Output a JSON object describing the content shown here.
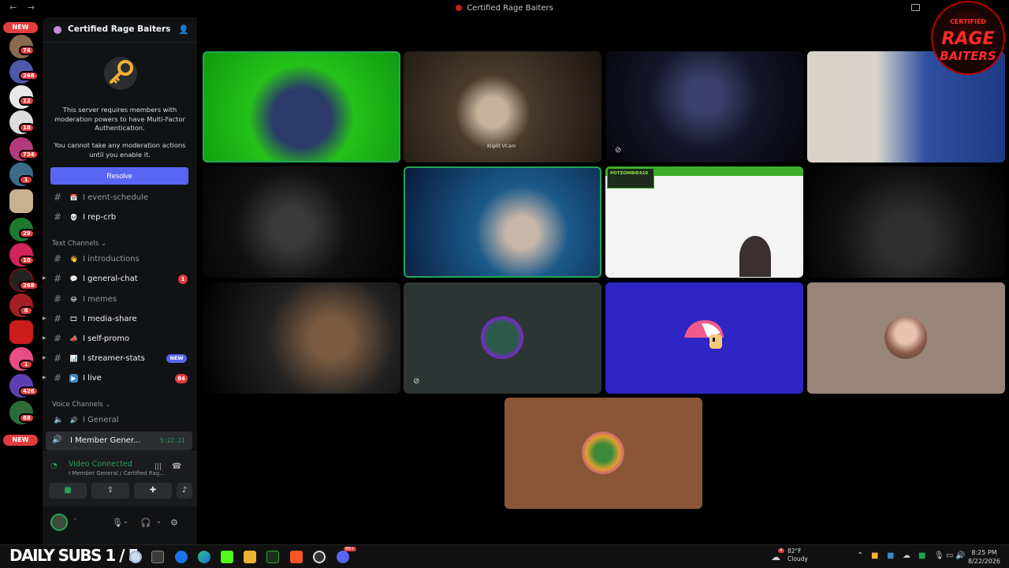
{
  "window": {
    "title": "Certified Rage Baiters",
    "back": "←",
    "forward": "→"
  },
  "rail": {
    "new_top": "NEW",
    "new_bottom": "NEW",
    "badges": [
      "74",
      "268",
      "12",
      "18",
      "734",
      "1",
      "29",
      "10",
      "268",
      "8",
      "1",
      "426",
      "68"
    ]
  },
  "server": {
    "name": "Certified Rage Baiters",
    "chevron": "⌄",
    "invite_icon": "add-user-icon"
  },
  "mfa_notice": {
    "text1": "This server requires members with moderation powers to have Multi-Factor Authentication.",
    "text2": "You cannot take any moderation actions until you enable it.",
    "button": "Resolve"
  },
  "channels_top": [
    {
      "emoji": "📅",
      "label": "I event-schedule",
      "bright": false
    },
    {
      "emoji": "💀",
      "label": "I rep-crb",
      "bright": true
    }
  ],
  "text_category": "Text Channels",
  "text_channels": [
    {
      "emoji": "👋",
      "label": "I introductions",
      "bright": false,
      "badge": ""
    },
    {
      "emoji": "💬",
      "label": "I general-chat",
      "bright": true,
      "badge": "1"
    },
    {
      "emoji": "😂",
      "label": "I memes",
      "bright": false,
      "badge": ""
    },
    {
      "emoji": "🎞",
      "label": "I media-share",
      "bright": true,
      "badge": ""
    },
    {
      "emoji": "📣",
      "label": "I self-promo",
      "bright": true,
      "badge": ""
    },
    {
      "emoji": "📊",
      "label": "I streamer-stats",
      "bright": true,
      "badge": "NEW"
    },
    {
      "emoji": "▶",
      "label": "I live",
      "bright": true,
      "badge": "84"
    }
  ],
  "voice_category": "Voice Channels",
  "voice_channels": [
    {
      "label": "I General"
    }
  ],
  "active_voice": {
    "label": "I Member Gener...",
    "time": "5:22:21"
  },
  "rtc": {
    "status": "Video Connected",
    "channel": "I Member General / Certified Rag..."
  },
  "user": {
    "name": "·",
    "sub": "·"
  },
  "taskbar": {
    "subs": "DAILY SUBS 1 / 5",
    "weather_temp": "82°F",
    "weather_desc": "Cloudy",
    "weather_badge": "4",
    "discord_badge": "99+",
    "time": "8:25 PM",
    "date": "8/22/2026"
  },
  "tiles": [
    {
      "name": "green-screen-participant",
      "note": ""
    },
    {
      "name": "blonde-participant",
      "note": "Kliplit VCam"
    },
    {
      "name": "dark-room-participant",
      "note": ""
    },
    {
      "name": "blue-room-participant",
      "note": ""
    },
    {
      "name": "hooded-participant",
      "note": ""
    },
    {
      "name": "cap-participant",
      "note": ""
    },
    {
      "name": "potzombie-participant",
      "note": "POTZOMBIE420"
    },
    {
      "name": "stretching-participant",
      "note": ""
    },
    {
      "name": "ny-cap-participant",
      "note": ""
    },
    {
      "name": "avatar-participant-1",
      "note": ""
    },
    {
      "name": "avatar-participant-2",
      "note": ""
    },
    {
      "name": "avatar-participant-3",
      "note": ""
    },
    {
      "name": "avatar-participant-4",
      "note": ""
    }
  ],
  "overlay_logo": {
    "line1": "CERTIFIED",
    "line2": "RAGE",
    "line3": "BAITERS"
  },
  "colors": {
    "blurple": "#5865f2",
    "green": "#23a55a",
    "red": "#e23c3f",
    "tile_blue": "#2e25c4",
    "tile_slate": "#2d3534",
    "tile_mauve": "#9a857a",
    "tile_brown": "#8a5636"
  }
}
